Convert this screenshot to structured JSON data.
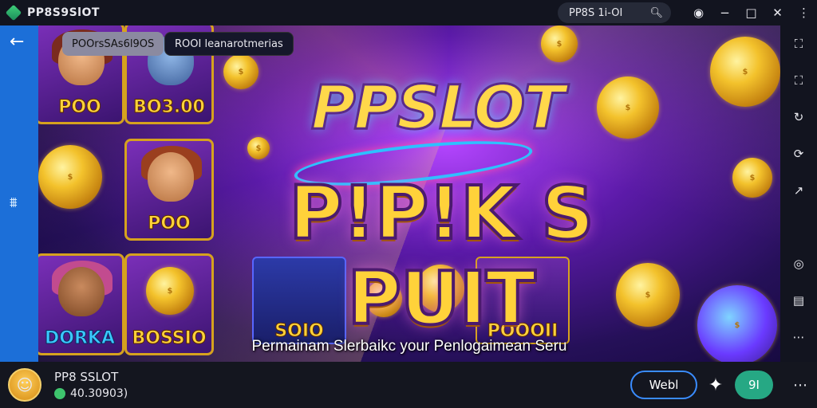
{
  "window": {
    "app_title": "PP8S9SlOT",
    "search_text": "PP8S 1i-OI",
    "icons": [
      "app-logo-icon",
      "search-icon",
      "record-icon",
      "minimize-icon",
      "maximize-icon",
      "close-icon",
      "more-vertical-icon"
    ]
  },
  "left_rail": {
    "icons": [
      "back-arrow-icon",
      "swap-icon"
    ]
  },
  "banner": {
    "tab_1": "POOrsSAs6l9OS",
    "tab_2": "ROOI leanarotmerias",
    "logo_top": "PPSLOT",
    "logo_bottom": "P!P!K S PUIT",
    "caption": "Permainam Slerbaikc your Penlogaimean Seru",
    "tiles": [
      {
        "label": "POO"
      },
      {
        "label": "BO3.00"
      },
      {
        "label": "POO"
      },
      {
        "label": "DORKA"
      },
      {
        "label": "BOSSIO"
      },
      {
        "label": "SOIO"
      },
      {
        "label": "POOOII"
      }
    ]
  },
  "right_rail": {
    "icons": [
      "scan-frame-icon",
      "scan-frame-2-icon",
      "rotate-icon",
      "refresh-icon",
      "cursor-icon",
      "location-icon",
      "layers-icon",
      "more-horizontal-icon",
      "arrow-down-icon"
    ]
  },
  "bottom_bar": {
    "user_name": "PP8 SSLOT",
    "balance": "40.30903)",
    "web_button": "Webl",
    "green_button": "9I",
    "icons": [
      "avatar-icon",
      "coin-icon",
      "puzzle-icon",
      "more-icon"
    ]
  },
  "colors": {
    "accent_blue": "#1c6fd8",
    "green": "#26a884",
    "gold": "#ffd23a",
    "purple": "#5b1aa8"
  }
}
